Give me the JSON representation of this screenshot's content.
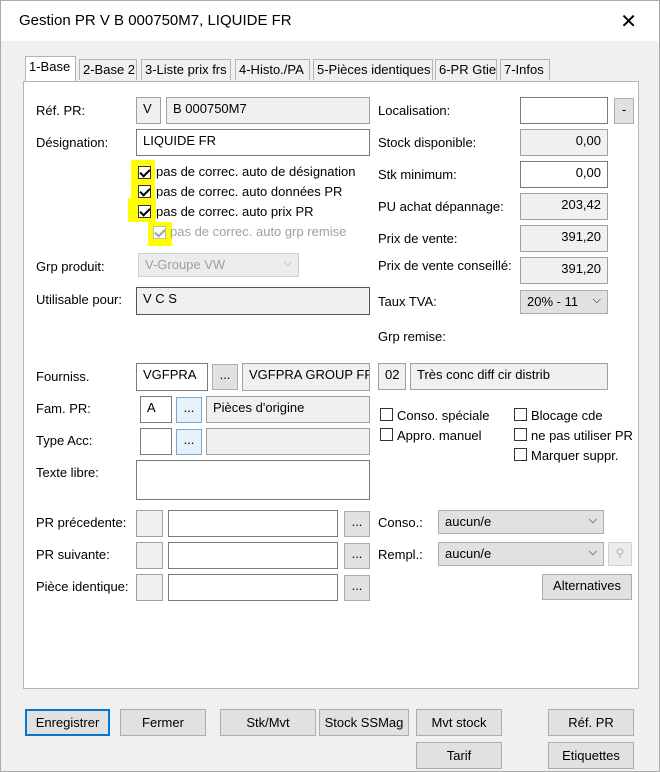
{
  "window": {
    "title": "Gestion PR   V B  000750M7, LIQUIDE FR",
    "close_glyph": "✕"
  },
  "tabs": [
    {
      "label": "1-Base",
      "active": true
    },
    {
      "label": "2-Base 2"
    },
    {
      "label": "3-Liste prix frs"
    },
    {
      "label": "4-Histo./PA"
    },
    {
      "label": "5-Pièces identiques"
    },
    {
      "label": "6-PR Gtie"
    },
    {
      "label": "7-Infos"
    }
  ],
  "left": {
    "ref_pr_label": "Réf. PR:",
    "ref_pr_prefix": "V",
    "ref_pr_value": "B  000750M7",
    "designation_label": "Désignation:",
    "designation_value": "LIQUIDE FR",
    "checks": [
      {
        "label": "pas de correc. auto de désignation",
        "checked": true
      },
      {
        "label": "pas de correc. auto données PR",
        "checked": true
      },
      {
        "label": "pas de correc. auto prix PR",
        "checked": true
      },
      {
        "label": "pas de correc. auto grp remise",
        "checked": true,
        "disabled": true
      }
    ],
    "grp_produit_label": "Grp produit:",
    "grp_produit_value": "V-Groupe VW",
    "utilisable_label": "Utilisable pour:",
    "utilisable_value": "V C S",
    "fourniss_label": "Fourniss.",
    "fourniss_code": "VGFPRA",
    "fourniss_name": "VGFPRA GROUP FRA",
    "fam_pr_label": "Fam. PR:",
    "fam_pr_code": "A",
    "fam_pr_name": "Pièces d'origine",
    "type_acc_label": "Type Acc:",
    "texte_libre_label": "Texte libre:",
    "pr_prec_label": "PR précedente:",
    "pr_suiv_label": "PR suivante:",
    "piece_ident_label": "Pièce identique:",
    "dots": "..."
  },
  "right": {
    "localisation_label": "Localisation:",
    "localisation_btn": "-",
    "stock_dispo_label": "Stock disponible:",
    "stock_dispo_value": "0,00",
    "stk_min_label": "Stk minimum:",
    "stk_min_value": "0,00",
    "pu_achat_label": "PU achat dépannage:",
    "pu_achat_value": "203,42",
    "prix_vente_label": "Prix de vente:",
    "prix_vente_value": "391,20",
    "prix_conseille_label": "Prix de vente conseillé:",
    "prix_conseille_value": "391,20",
    "taux_tva_label": "Taux TVA:",
    "taux_tva_value": "20% - 11",
    "grp_remise_label": "Grp remise:",
    "grp_remise_code": "02",
    "grp_remise_name": "Très conc diff cir distrib",
    "checks_left": [
      {
        "label": "Conso. spéciale",
        "checked": false
      },
      {
        "label": "Appro. manuel",
        "checked": false
      }
    ],
    "checks_right": [
      {
        "label": "Blocage cde",
        "checked": false
      },
      {
        "label": "ne pas utiliser PR",
        "checked": false
      },
      {
        "label": "Marquer suppr.",
        "checked": false
      }
    ],
    "conso_label": "Conso.:",
    "conso_value": "aucun/e",
    "rempl_label": "Rempl.:",
    "rempl_value": "aucun/e",
    "alternatives_btn": "Alternatives"
  },
  "footer": {
    "enregistrer": "Enregistrer",
    "fermer": "Fermer",
    "stk_mvt": "Stk/Mvt",
    "stock_ssmag": "Stock SSMag",
    "mvt_stock": "Mvt stock",
    "ref_pr": "Réf. PR",
    "tarif": "Tarif",
    "etiquettes": "Etiquettes"
  },
  "colors": {
    "highlight": "#ffff00",
    "accent": "#0078d7"
  }
}
